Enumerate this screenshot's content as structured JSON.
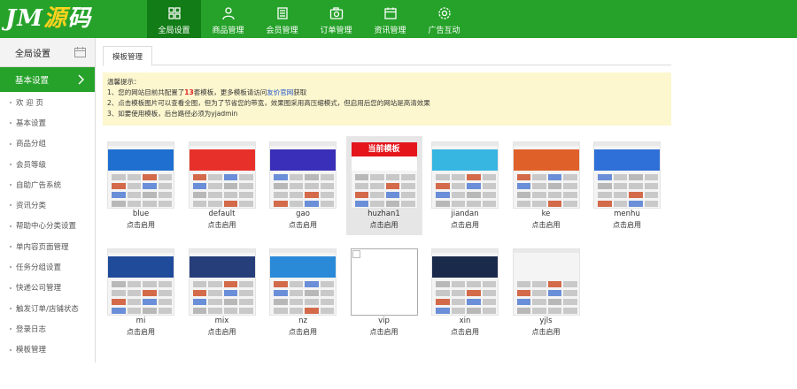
{
  "logo": {
    "part1": "JM",
    "part2": "源",
    "part3": "码"
  },
  "nav": [
    {
      "label": "全局设置",
      "icon": "grid-icon",
      "active": true
    },
    {
      "label": "商品管理",
      "icon": "user-icon",
      "active": false
    },
    {
      "label": "会员管理",
      "icon": "book-icon",
      "active": false
    },
    {
      "label": "订单管理",
      "icon": "camera-icon",
      "active": false
    },
    {
      "label": "资讯管理",
      "icon": "calendar-icon",
      "active": false
    },
    {
      "label": "广告互动",
      "icon": "gear-icon",
      "active": false
    }
  ],
  "sidebar": {
    "title": "全局设置",
    "category": "基本设置",
    "items": [
      "欢 迎 页",
      "基本设置",
      "商品分组",
      "会员等级",
      "自助广告系统",
      "资讯分类",
      "帮助中心分类设置",
      "单内容页面管理",
      "任务分组设置",
      "快递公司管理",
      "触发订单/店铺状态",
      "登录日志",
      "模板管理"
    ]
  },
  "main": {
    "tab": "模板管理",
    "notice": {
      "title": "温馨提示：",
      "line1_a": "1、您的网站目前共配置了",
      "line1_count": "13",
      "line1_b": "套模板，更多模板请访问",
      "line1_link": "友价官网",
      "line1_c": "获取",
      "line2": "2、点击模板图片可以查看全图，但为了节省您的带宽，效果图采用高压缩模式，但启用后您的网站是高清效果",
      "line3": "3、如要使用模板，后台路径必须为yjadmin"
    },
    "current_badge": "当前模板",
    "themes": [
      {
        "name": "blue",
        "action": "点击启用",
        "color": "#1e6fd0"
      },
      {
        "name": "default",
        "action": "点击启用",
        "color": "#e8302a"
      },
      {
        "name": "gao",
        "action": "点击启用",
        "color": "#3a2fb8"
      },
      {
        "name": "huzhan1",
        "action": "点击启用",
        "color": "#ffffff",
        "current": true
      },
      {
        "name": "jiandan",
        "action": "点击启用",
        "color": "#36b6e0"
      },
      {
        "name": "ke",
        "action": "点击启用",
        "color": "#e0602a"
      },
      {
        "name": "menhu",
        "action": "点击启用",
        "color": "#2f6fd8"
      },
      {
        "name": "mi",
        "action": "点击启用",
        "color": "#204a9a"
      },
      {
        "name": "mix",
        "action": "点击启用",
        "color": "#263e7a"
      },
      {
        "name": "nz",
        "action": "点击启用",
        "color": "#2a8ad8"
      },
      {
        "name": "vip",
        "action": "点击启用",
        "color": "#ffffff",
        "broken": true
      },
      {
        "name": "xin",
        "action": "点击启用",
        "color": "#1a2a4a"
      },
      {
        "name": "yjls",
        "action": "点击启用",
        "color": "#f4f4f4"
      }
    ]
  }
}
